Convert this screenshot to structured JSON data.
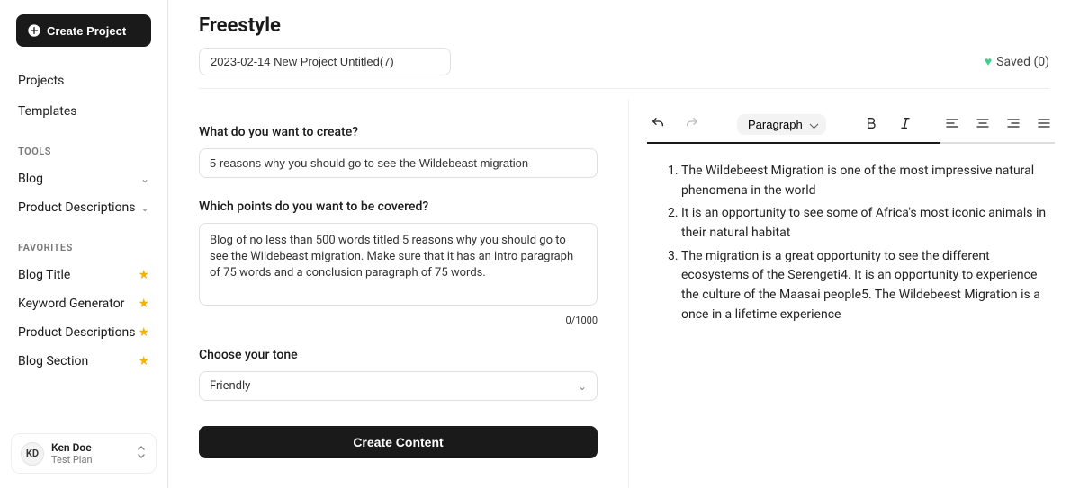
{
  "sidebar": {
    "create_label": "Create Project",
    "projects_label": "Projects",
    "templates_label": "Templates",
    "tools_label": "TOOLS",
    "blog_label": "Blog",
    "product_desc_label": "Product Descriptions",
    "favorites_label": "FAVORITES",
    "favs": [
      "Blog Title",
      "Keyword Generator",
      "Product Descriptions",
      "Blog Section"
    ],
    "user": {
      "initials": "KD",
      "name": "Ken Doe",
      "plan": "Test Plan"
    }
  },
  "header": {
    "title": "Freestyle",
    "project_name": "2023-02-14 New Project Untitled(7)",
    "saved_label": "Saved (0)"
  },
  "form": {
    "q1_label": "What do you want to create?",
    "q1_value": "5 reasons why you should go to see the Wildebeast migration",
    "q2_label": "Which points do you want to be covered?",
    "q2_value": "Blog of no less than 500 words titled 5 reasons why you should go to see the Wildebeast migration. Make sure that it has an intro paragraph of 75 words and a conclusion paragraph of 75 words.",
    "counter": "0/1000",
    "tone_label": "Choose your tone",
    "tone_value": "Friendly",
    "submit_label": "Create Content"
  },
  "toolbar": {
    "para_label": "Paragraph"
  },
  "editor": {
    "items": [
      "The Wildebeest Migration is one of the most impressive natural phenomena in the world",
      "It is an opportunity to see some of Africa's most iconic animals in their natural habitat",
      "The migration is a great opportunity to see the different ecosystems of the Serengeti4. It is an opportunity to experience the culture of the Maasai people5. The Wildebeest Migration is a once in a lifetime experience"
    ]
  }
}
